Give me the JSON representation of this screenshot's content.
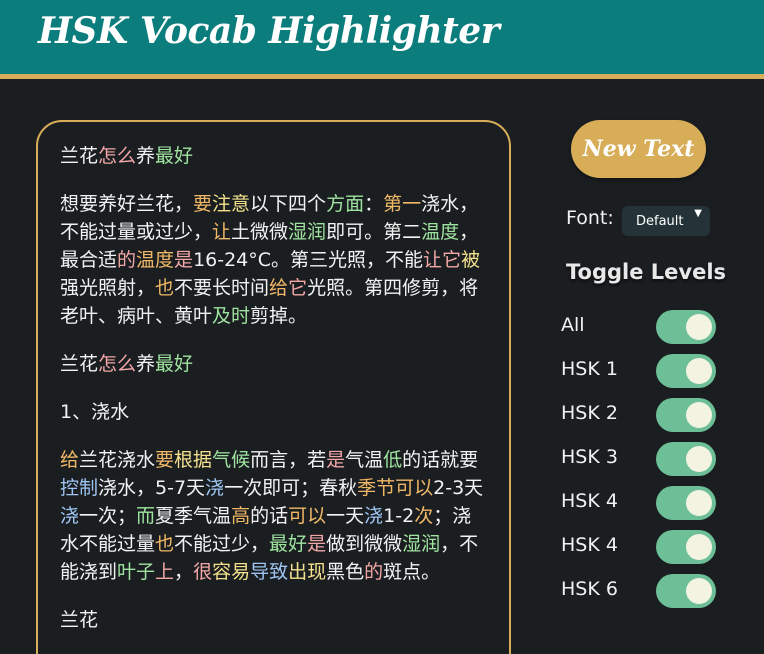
{
  "header": {
    "title": "HSK Vocab Highlighter"
  },
  "controls": {
    "new_text_label": "New Text",
    "font_label": "Font:",
    "font_value": "Default",
    "toggle_title": "Toggle Levels",
    "levels": [
      {
        "label": "All",
        "on": true
      },
      {
        "label": "HSK 1",
        "on": true
      },
      {
        "label": "HSK 2",
        "on": true
      },
      {
        "label": "HSK 3",
        "on": true
      },
      {
        "label": "HSK 4",
        "on": true
      },
      {
        "label": "HSK 4",
        "on": true
      },
      {
        "label": "HSK 6",
        "on": true
      }
    ]
  },
  "colors": {
    "header_bg": "#0c7d7d",
    "accent": "#d8ad58",
    "hsk1": "#f3a7a7",
    "hsk2": "#9fe3a0",
    "hsk3": "#f2e08c",
    "hsk4": "#9ec5f2",
    "hsk5": "#f0b866",
    "toggle_on": "#6dbf97"
  },
  "paragraphs": [
    [
      {
        "t": "兰花",
        "c": null
      },
      {
        "t": "怎么",
        "c": "hsk1"
      },
      {
        "t": "养",
        "c": null
      },
      {
        "t": "最好",
        "c": "hsk2"
      }
    ],
    [
      {
        "t": "想要养好兰花，",
        "c": null
      },
      {
        "t": "要",
        "c": "hsk5"
      },
      {
        "t": "注意",
        "c": "hsk3"
      },
      {
        "t": "以下四个",
        "c": null
      },
      {
        "t": "方面",
        "c": "hsk2"
      },
      {
        "t": "：",
        "c": null
      },
      {
        "t": "第一",
        "c": "hsk5"
      },
      {
        "t": "浇水，不能过量或过少，",
        "c": null
      },
      {
        "t": "让",
        "c": "hsk5"
      },
      {
        "t": "土微微",
        "c": null
      },
      {
        "t": "湿润",
        "c": "hsk2"
      },
      {
        "t": "即可。第二",
        "c": null
      },
      {
        "t": "温度",
        "c": "hsk2"
      },
      {
        "t": "，最合适",
        "c": null
      },
      {
        "t": "的",
        "c": "hsk1"
      },
      {
        "t": "温度",
        "c": "hsk5"
      },
      {
        "t": "是",
        "c": "hsk1"
      },
      {
        "t": "16-24°C。第三光照，不能",
        "c": null
      },
      {
        "t": "让",
        "c": "hsk1"
      },
      {
        "t": "它",
        "c": "hsk1"
      },
      {
        "t": "被",
        "c": "hsk3"
      },
      {
        "t": "强光照射，",
        "c": null
      },
      {
        "t": "也",
        "c": "hsk5"
      },
      {
        "t": "不要长时间",
        "c": null
      },
      {
        "t": "给",
        "c": "hsk5"
      },
      {
        "t": "它",
        "c": "hsk1"
      },
      {
        "t": "光照。第四修剪，将老叶、病叶、黄叶",
        "c": null
      },
      {
        "t": "及时",
        "c": "hsk2"
      },
      {
        "t": "剪掉。",
        "c": null
      }
    ],
    [
      {
        "t": "兰花",
        "c": null
      },
      {
        "t": "怎么",
        "c": "hsk1"
      },
      {
        "t": "养",
        "c": null
      },
      {
        "t": "最好",
        "c": "hsk2"
      }
    ],
    [
      {
        "t": "1、浇水",
        "c": null
      }
    ],
    [
      {
        "t": "给",
        "c": "hsk5"
      },
      {
        "t": "兰花浇水",
        "c": null
      },
      {
        "t": "要",
        "c": "hsk5"
      },
      {
        "t": "根据",
        "c": "hsk3"
      },
      {
        "t": "气候",
        "c": "hsk2"
      },
      {
        "t": "而言，若",
        "c": null
      },
      {
        "t": "是",
        "c": "hsk1"
      },
      {
        "t": "气温",
        "c": null
      },
      {
        "t": "低",
        "c": "hsk2"
      },
      {
        "t": "的话就要",
        "c": null
      },
      {
        "t": "控制",
        "c": "hsk4"
      },
      {
        "t": "浇水，5-7天",
        "c": null
      },
      {
        "t": "浇",
        "c": "hsk4"
      },
      {
        "t": "一次即可；春秋",
        "c": null
      },
      {
        "t": "季节",
        "c": "hsk5"
      },
      {
        "t": "可以",
        "c": "hsk5"
      },
      {
        "t": "2-3天",
        "c": null
      },
      {
        "t": "浇",
        "c": "hsk4"
      },
      {
        "t": "一次；",
        "c": null
      },
      {
        "t": "而",
        "c": "hsk2"
      },
      {
        "t": "夏季气温",
        "c": null
      },
      {
        "t": "高",
        "c": "hsk5"
      },
      {
        "t": "的话",
        "c": null
      },
      {
        "t": "可以",
        "c": "hsk5"
      },
      {
        "t": "一天",
        "c": null
      },
      {
        "t": "浇",
        "c": "hsk4"
      },
      {
        "t": "1-2",
        "c": null
      },
      {
        "t": "次",
        "c": "hsk5"
      },
      {
        "t": "；浇水不能过量",
        "c": null
      },
      {
        "t": "也",
        "c": "hsk5"
      },
      {
        "t": "不能过少，",
        "c": null
      },
      {
        "t": "最好",
        "c": "hsk2"
      },
      {
        "t": "是",
        "c": "hsk1"
      },
      {
        "t": "做到微微",
        "c": null
      },
      {
        "t": "湿润",
        "c": "hsk2"
      },
      {
        "t": "，不能浇到",
        "c": null
      },
      {
        "t": "叶子",
        "c": "hsk2"
      },
      {
        "t": "上",
        "c": "hsk1"
      },
      {
        "t": "，",
        "c": null
      },
      {
        "t": "很",
        "c": "hsk1"
      },
      {
        "t": "容易",
        "c": "hsk3"
      },
      {
        "t": "导致",
        "c": "hsk4"
      },
      {
        "t": "出现",
        "c": "hsk3"
      },
      {
        "t": "黑色",
        "c": null
      },
      {
        "t": "的",
        "c": "hsk1"
      },
      {
        "t": "斑点。",
        "c": null
      }
    ],
    [
      {
        "t": "兰花",
        "c": null
      }
    ]
  ]
}
